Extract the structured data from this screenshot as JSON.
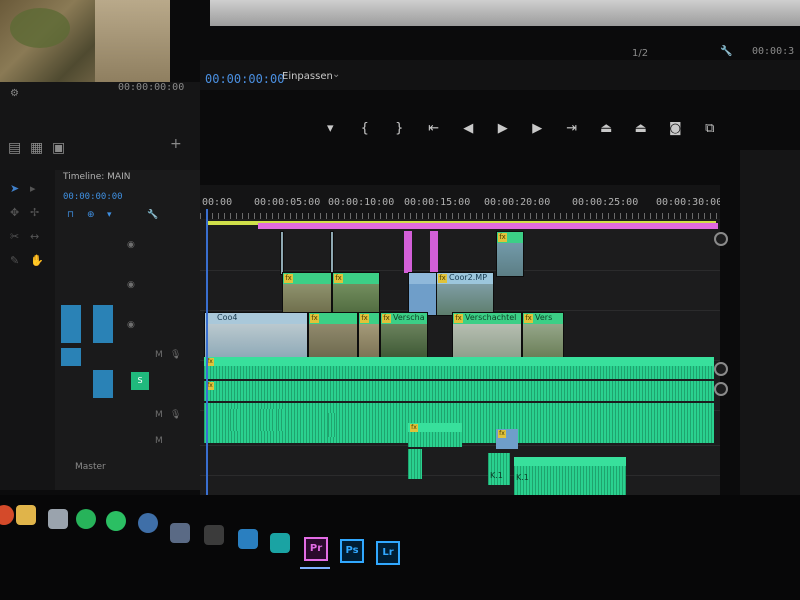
{
  "source_monitor": {
    "timecode": "00:00:00:00"
  },
  "program_monitor": {
    "timecode": "00:00:00:00",
    "fit_label": "Einpassen",
    "resolution": "1/2",
    "right_timecode": "00:00:3"
  },
  "transport": {
    "buttons": [
      "marker",
      "in-point",
      "out-point",
      "go-to-in",
      "step-back",
      "play",
      "step-forward",
      "go-to-out",
      "lift",
      "extract",
      "export-frame",
      "compare"
    ]
  },
  "sequence": {
    "name": "Timeline: MAIN",
    "timecode": "00:00:00:00"
  },
  "timeline": {
    "ruler_labels": [
      "00:00",
      "00:00:05:00",
      "00:00:10:00",
      "00:00:15:00",
      "00:00:20:00",
      "00:00:25:00",
      "00:00:30:00"
    ],
    "clips": {
      "v2_left": "Coo4",
      "v2_right": "Coor2.MP",
      "v1_a": "Verscha",
      "v1_b": "Verschachtel",
      "v1_c": "Vers",
      "a_k1_left": "K.1",
      "a_k1_right": "K.1",
      "fx_badge": "fx"
    },
    "track_header_footer": "Master"
  },
  "taskbar": {
    "apps": [
      {
        "name": "premiere",
        "label": "Pr",
        "color": "#e36ce5"
      },
      {
        "name": "photoshop",
        "label": "Ps",
        "color": "#31a8ff"
      },
      {
        "name": "lightroom",
        "label": "Lr",
        "color": "#31a8ff"
      }
    ]
  }
}
